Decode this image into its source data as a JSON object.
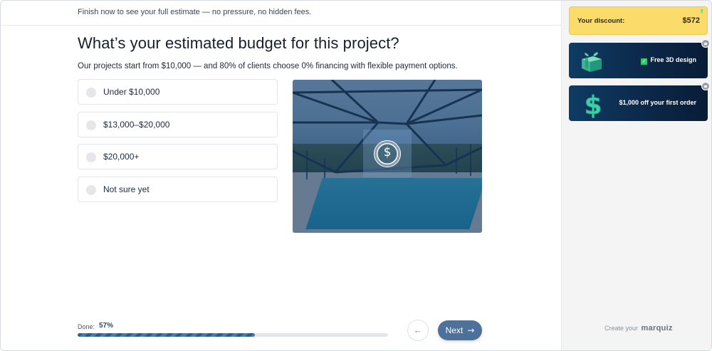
{
  "header": {
    "banner_text": "Finish now to see your full estimate — no pressure, no hidden fees."
  },
  "main": {
    "question": "What’s your estimated budget for this project?",
    "subtitle": "Our projects start from $10,000 — and 80% of clients choose 0% financing with flexible payment options.",
    "options": [
      {
        "label": "Under $10,000"
      },
      {
        "label": "$13,000–$20,000"
      },
      {
        "label": "$20,000+"
      },
      {
        "label": "Not sure yet"
      }
    ],
    "image_icon": "dollar-icon",
    "image_symbol": "$"
  },
  "footer": {
    "done_label": "Done:",
    "progress_text": "57%",
    "progress_fraction": 0.57,
    "back_icon": "arrow-left-icon",
    "back_symbol": "←",
    "next_label": "Next",
    "next_symbol": "→"
  },
  "sidebar": {
    "discount_label": "Your discount:",
    "discount_value": "$572",
    "bonuses": [
      {
        "label": "Free 3D design",
        "icon": "gift-icon",
        "locked": true,
        "checked": true
      },
      {
        "label": "$1,000 off your first order",
        "icon": "money-icon",
        "locked": true,
        "checked": false
      }
    ],
    "create_prefix": "Create your",
    "brand": "marquiz"
  },
  "colors": {
    "accent": "#4d7198",
    "progress": "#2f5b85",
    "discount_bg": "#fbdc6a",
    "bonus_bg": "#0b2747"
  }
}
